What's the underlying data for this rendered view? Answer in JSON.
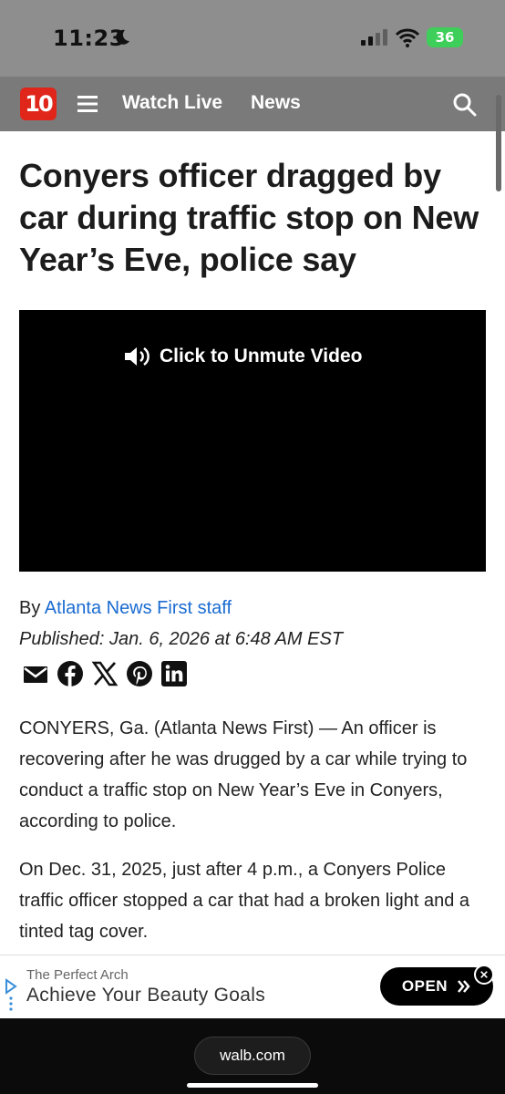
{
  "status_bar": {
    "time": "11:23",
    "battery": "36"
  },
  "nav": {
    "logo": "10",
    "watch_live": "Watch Live",
    "news": "News"
  },
  "article": {
    "headline": "Conyers officer dragged by car during traffic stop on New Year’s Eve, police say",
    "video_unmute": "Click to Unmute Video",
    "byline_prefix": "By ",
    "author": "Atlanta News First staff",
    "published": "Published: Jan. 6, 2026 at 6:48 AM EST",
    "paragraphs": [
      "CONYERS, Ga. (Atlanta News First) — An officer is recovering after he was drugged by a car while trying to conduct a traffic stop on New Year’s Eve in Conyers, according to police.",
      "On Dec. 31, 2025, just after 4 p.m., a Conyers Police traffic officer stopped a car that had a broken light and a tinted tag cover."
    ],
    "share_icons": [
      "email-icon",
      "facebook-icon",
      "x-icon",
      "pinterest-icon",
      "linkedin-icon"
    ]
  },
  "ad": {
    "brand": "The Perfect Arch",
    "headline": "Achieve Your Beauty Goals",
    "cta": "OPEN",
    "cta_icon": "double-chevron-right-icon"
  },
  "browser": {
    "url": "walb.com"
  },
  "colors": {
    "accent_red": "#e0261b",
    "link_blue": "#1a6bd1",
    "battery_green": "#3ecf5a"
  }
}
